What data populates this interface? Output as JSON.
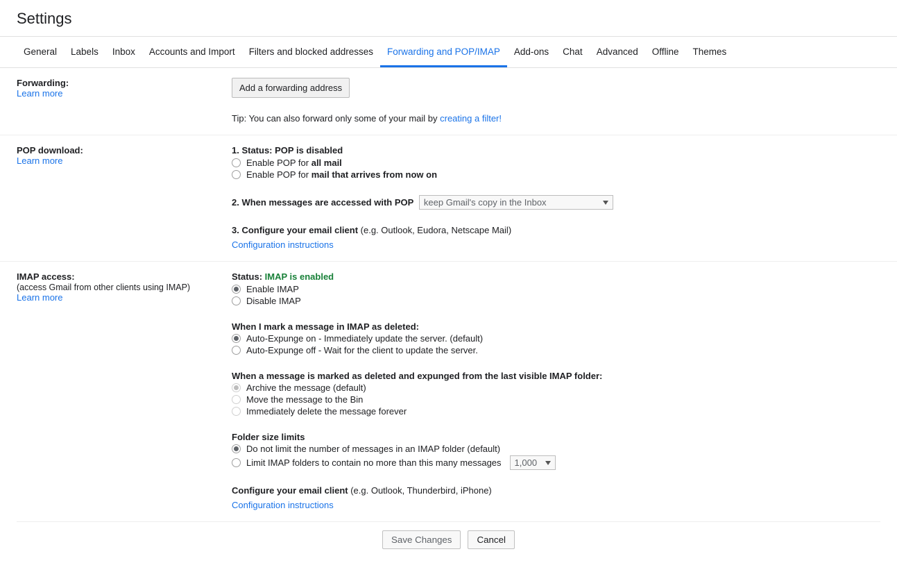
{
  "page_title": "Settings",
  "tabs": {
    "general": "General",
    "labels": "Labels",
    "inbox": "Inbox",
    "accounts": "Accounts and Import",
    "filters": "Filters and blocked addresses",
    "forwarding": "Forwarding and POP/IMAP",
    "addons": "Add-ons",
    "chat": "Chat",
    "advanced": "Advanced",
    "offline": "Offline",
    "themes": "Themes"
  },
  "forwarding": {
    "label": "Forwarding:",
    "learn": "Learn more",
    "add_btn": "Add a forwarding address",
    "tip_prefix": "Tip: You can also forward only some of your mail by ",
    "tip_link": "creating a filter!"
  },
  "pop": {
    "label": "POP download:",
    "learn": "Learn more",
    "status_prefix": "1. Status: ",
    "status_value": "POP is disabled",
    "opt1_prefix": "Enable POP for ",
    "opt1_bold": "all mail",
    "opt2_prefix": "Enable POP for ",
    "opt2_bold": "mail that arrives from now on",
    "when_label": "2. When messages are accessed with POP",
    "select_value": "keep Gmail's copy in the Inbox",
    "configure_prefix": "3. Configure your email client ",
    "configure_suffix": "(e.g. Outlook, Eudora, Netscape Mail)",
    "config_link": "Configuration instructions"
  },
  "imap": {
    "label": "IMAP access:",
    "sub": "(access Gmail from other clients using IMAP)",
    "learn": "Learn more",
    "status_prefix": "Status: ",
    "status_value": "IMAP is enabled",
    "opt_enable": "Enable IMAP",
    "opt_disable": "Disable IMAP",
    "delete_header": "When I mark a message in IMAP as deleted:",
    "del_opt1": "Auto-Expunge on - Immediately update the server. (default)",
    "del_opt2": "Auto-Expunge off - Wait for the client to update the server.",
    "expunge_header": "When a message is marked as deleted and expunged from the last visible IMAP folder:",
    "exp_opt1": "Archive the message (default)",
    "exp_opt2": "Move the message to the Bin",
    "exp_opt3": "Immediately delete the message forever",
    "folder_header": "Folder size limits",
    "fold_opt1": "Do not limit the number of messages in an IMAP folder (default)",
    "fold_opt2": "Limit IMAP folders to contain no more than this many messages",
    "fold_select": "1,000",
    "configure_prefix": "Configure your email client ",
    "configure_suffix": "(e.g. Outlook, Thunderbird, iPhone)",
    "config_link": "Configuration instructions"
  },
  "footer": {
    "save": "Save Changes",
    "cancel": "Cancel"
  }
}
